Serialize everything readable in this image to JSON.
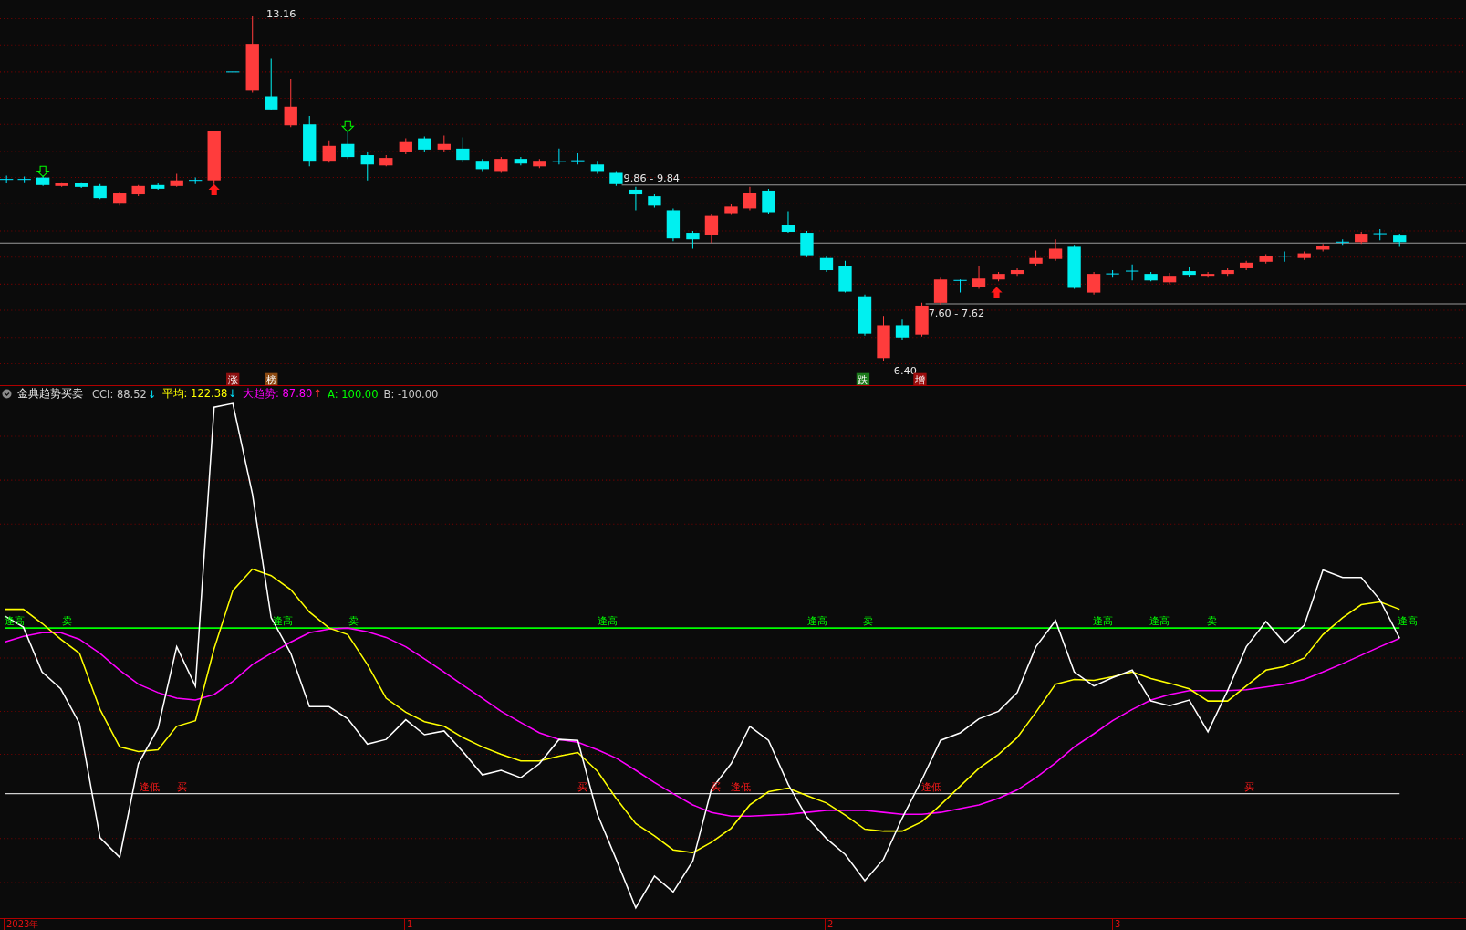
{
  "price_chart": {
    "price_labels": [
      {
        "text": "13.16"
      },
      {
        "text": "9.86 - 9.84"
      },
      {
        "text": "7.60 - 7.62"
      },
      {
        "text": "6.40"
      }
    ],
    "badges": [
      {
        "text": "涨",
        "color": "#8b0f0f"
      },
      {
        "text": "榜",
        "color": "#8b4a12"
      },
      {
        "text": "跌",
        "color": "#1c7a1c"
      },
      {
        "text": "增",
        "color": "#9a0c0c"
      }
    ]
  },
  "indicator": {
    "name": "金典趋势买卖",
    "legend": [
      {
        "label": "CCI: 88.52",
        "arrow": "↓",
        "color": "#c8c8c8",
        "kind": "falling"
      },
      {
        "label": "平均: 122.38",
        "arrow": "↓",
        "color": "#ffff00",
        "kind": "falling"
      },
      {
        "label": "大趋势: 87.80",
        "arrow": "↑",
        "color": "#ff00ff",
        "kind": "rising"
      },
      {
        "label": "A: 100.00",
        "color": "#00ff00"
      },
      {
        "label": "B: -100.00",
        "color": "#c8c8c8"
      }
    ],
    "signals": [
      {
        "text": "逢高",
        "kind": "high"
      },
      {
        "text": "卖",
        "kind": "high"
      },
      {
        "text": "逢高",
        "kind": "high"
      },
      {
        "text": "卖",
        "kind": "high"
      },
      {
        "text": "逢高",
        "kind": "high"
      },
      {
        "text": "逢高",
        "kind": "high"
      },
      {
        "text": "卖",
        "kind": "high"
      },
      {
        "text": "逢高",
        "kind": "high"
      },
      {
        "text": "逢高",
        "kind": "high"
      },
      {
        "text": "卖",
        "kind": "high"
      },
      {
        "text": "逢高",
        "kind": "high"
      },
      {
        "text": "逢低",
        "kind": "low"
      },
      {
        "text": "买",
        "kind": "low"
      },
      {
        "text": "买",
        "kind": "low"
      },
      {
        "text": "买",
        "kind": "low"
      },
      {
        "text": "逢低",
        "kind": "low"
      },
      {
        "text": "逢低",
        "kind": "low"
      },
      {
        "text": "买",
        "kind": "low"
      }
    ]
  },
  "time_axis": [
    "2023年",
    "1",
    "2",
    "3"
  ]
}
